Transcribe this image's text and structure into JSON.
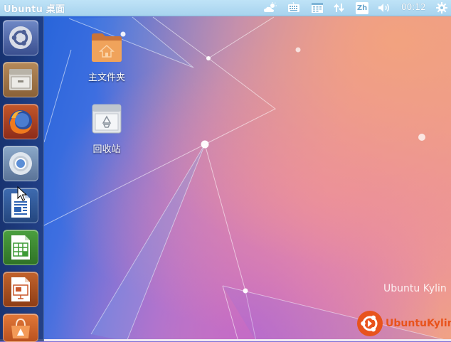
{
  "panel": {
    "title": "Ubuntu 桌面",
    "clock": "00:12",
    "input_method": "Zh",
    "indicators": [
      "weather-icon",
      "keyboard-icon",
      "calendar-icon",
      "network-icon",
      "input-method-icon",
      "volume-icon",
      "settings-gear-icon"
    ]
  },
  "launcher": {
    "items": [
      {
        "name": "dash-home",
        "icon": "ubuntu-logo-icon"
      },
      {
        "name": "files",
        "icon": "file-cabinet-icon"
      },
      {
        "name": "firefox",
        "icon": "firefox-icon"
      },
      {
        "name": "chromium",
        "icon": "chromium-icon"
      },
      {
        "name": "libreoffice-writer",
        "icon": "writer-document-icon"
      },
      {
        "name": "libreoffice-calc",
        "icon": "calc-spreadsheet-icon"
      },
      {
        "name": "libreoffice-impress",
        "icon": "impress-presentation-icon"
      },
      {
        "name": "software-center",
        "icon": "shopping-bag-icon"
      }
    ]
  },
  "desktop": {
    "icons": [
      {
        "label": "主文件夹",
        "icon": "home-folder-icon"
      },
      {
        "label": "回收站",
        "icon": "trash-icon"
      }
    ],
    "watermark": "Ubuntu Kylin",
    "logo_text": "UbuntuKylin"
  },
  "colors": {
    "panel": "#a7d3ee",
    "launcher": "#1c3470",
    "kylin_orange": "#e8531c"
  }
}
